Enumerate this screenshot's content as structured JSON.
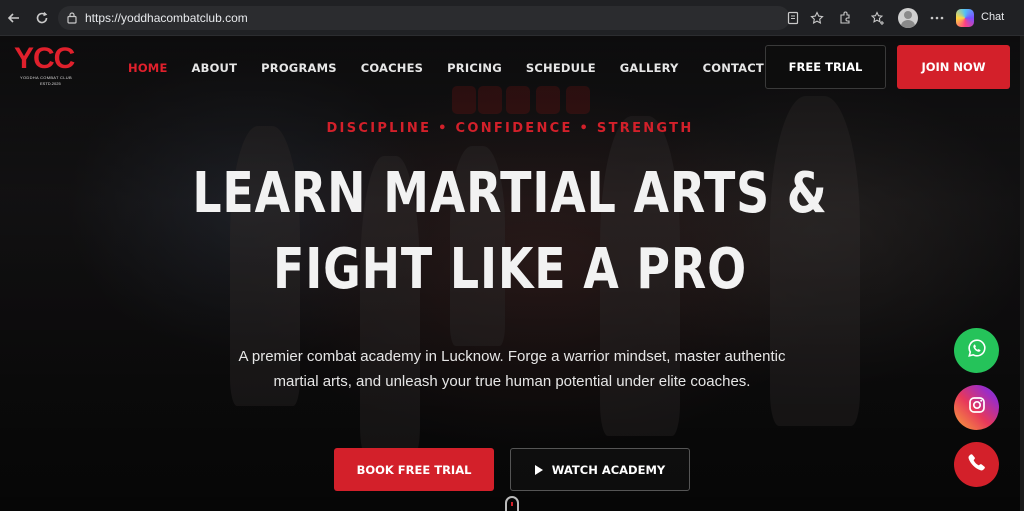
{
  "browser": {
    "url": "https://yoddhacombatclub.com",
    "chat_label": "Chat"
  },
  "header": {
    "logo_text": "YCC",
    "logo_subtitle": "YODDHA COMBAT CLUB",
    "logo_est": "ESTD.2025",
    "nav": [
      {
        "label": "HOME",
        "active": true
      },
      {
        "label": "ABOUT"
      },
      {
        "label": "PROGRAMS"
      },
      {
        "label": "COACHES"
      },
      {
        "label": "PRICING"
      },
      {
        "label": "SCHEDULE"
      },
      {
        "label": "GALLERY"
      },
      {
        "label": "CONTACT"
      }
    ],
    "free_trial_label": "FREE TRIAL",
    "join_label": "JOIN NOW"
  },
  "hero": {
    "eyebrow": "DISCIPLINE • CONFIDENCE • STRENGTH",
    "headline_line1": "LEARN MARTIAL ARTS &",
    "headline_line2": "FIGHT LIKE A PRO",
    "subcopy": "A premier combat academy in Lucknow. Forge a warrior mindset, master authentic martial arts, and unleash your true human potential under elite coaches.",
    "book_label": "BOOK FREE TRIAL",
    "watch_label": "WATCH ACADEMY"
  },
  "floating": [
    "whatsapp-icon",
    "instagram-icon",
    "phone-icon"
  ],
  "colors": {
    "accent": "#d3202a",
    "whatsapp": "#25c35a",
    "text": "#f2f2f2"
  }
}
